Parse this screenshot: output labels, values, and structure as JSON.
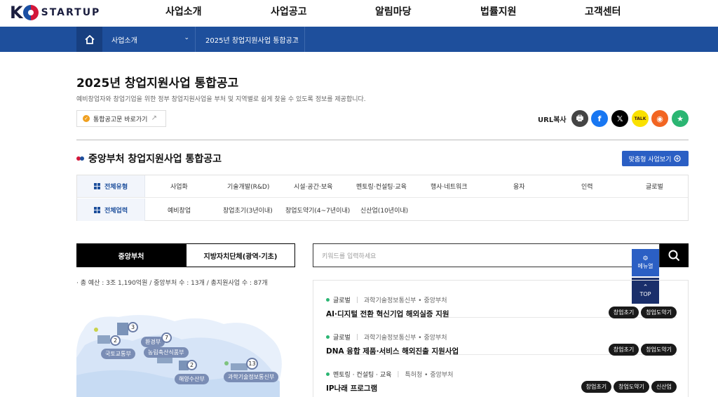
{
  "brand": {
    "logo_k": "K",
    "logo_text": "STARTUP"
  },
  "gnb": [
    "사업소개",
    "사업공고",
    "알림마당",
    "법률지원",
    "고객센터"
  ],
  "breadcrumb": {
    "level1": "사업소개",
    "level2": "2025년 창업지원사업 통합공고"
  },
  "page": {
    "title": "2025년 창업지원사업 통합공고",
    "desc": "예비창업자와 창업기업을 위한 정부 창업지원사업을 부처 및 지역별로 쉽게 찾을 수 있도록 정보를 제공합니다.",
    "link_label": "통합공고문 바로가기",
    "url_copy": "URL복사"
  },
  "share": {
    "print": "🖶",
    "facebook": "f",
    "x": "𝕏",
    "kakao": "TALK",
    "rss": "◉",
    "star": "★"
  },
  "section": {
    "title": "중앙부처 창업지원사업 통합공고",
    "match_button": "맞춤형 사업보기"
  },
  "filter": {
    "type_head": "전체유형",
    "types": [
      "사업화",
      "기술개발(R&D)",
      "시설·공간·보육",
      "멘토링·컨설팅·교육",
      "행사·네트워크",
      "융자",
      "인력",
      "글로벌"
    ],
    "age_head": "전체업력",
    "ages": [
      "예비창업",
      "창업초기(3년이내)",
      "창업도약기(4~7년이내)",
      "신산업(10년이내)"
    ]
  },
  "tabs": {
    "central": "중앙부처",
    "local": "지방자치단체(광역·기초)"
  },
  "budget": "· 총 예산 : 3조 1,190억원 / 중앙부처 수 : 13개 / 총지원사업 수 : 87개",
  "search": {
    "placeholder": "키워드를 입력하세요"
  },
  "quick": {
    "menu": "메뉴열",
    "top": "TOP"
  },
  "map": {
    "labels": [
      {
        "name": "국토교통부",
        "count": "2"
      },
      {
        "name": "환경부",
        "count": "3"
      },
      {
        "name": "농림축산식품부",
        "count": "7"
      },
      {
        "name": "해양수산부",
        "count": "2"
      },
      {
        "name": "과학기술정보통신부",
        "count": "13"
      }
    ]
  },
  "programs": [
    {
      "category": "글로벌",
      "org": "과학기술정보통신부 • 중앙부처",
      "title": "AI·디지털 전환 혁신기업 해외실증 지원",
      "tags": [
        "창업초기",
        "창업도약기"
      ]
    },
    {
      "category": "글로벌",
      "org": "과학기술정보통신부 • 중앙부처",
      "title": "DNA 융합 제품·서비스 해외진출 지원사업",
      "tags": [
        "창업초기",
        "창업도약기"
      ]
    },
    {
      "category": "멘토링 · 컨설팅 · 교육",
      "org": "특허청 • 중앙부처",
      "title": "IP나래 프로그램",
      "tags": [
        "창업초기",
        "창업도약기",
        "신산업"
      ]
    }
  ],
  "colors": {
    "nav_blue": "#1e4f9c",
    "accent_blue": "#2b5fc4",
    "green_dot": "#2bb673"
  }
}
